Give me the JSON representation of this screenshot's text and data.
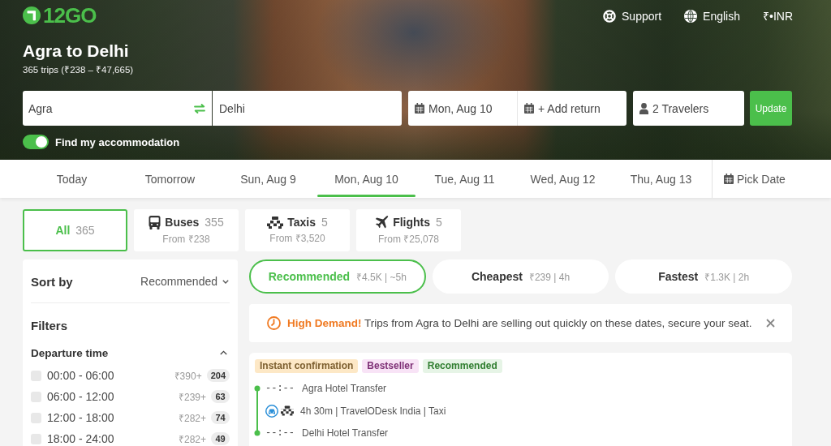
{
  "header": {
    "logo": "12GO",
    "links": [
      {
        "kind": "support",
        "label": "Support"
      },
      {
        "kind": "language",
        "label": "English"
      },
      {
        "kind": "currency",
        "label": "₹•INR"
      }
    ]
  },
  "route": {
    "title": "Agra to Delhi",
    "summary": "365 trips (₹238 – ₹47,665)"
  },
  "search": {
    "origin": "Agra",
    "destination": "Delhi",
    "date": "Mon, Aug 10",
    "return": "+ Add return",
    "travelers": "2 Travelers",
    "submit": "Update"
  },
  "accommodation": {
    "label": "Find my accommodation",
    "on": true
  },
  "date_tabs": [
    {
      "label": "Today",
      "selected": false
    },
    {
      "label": "Tomorrow",
      "selected": false
    },
    {
      "label": "Sun, Aug 9",
      "selected": false
    },
    {
      "label": "Mon, Aug 10",
      "selected": true
    },
    {
      "label": "Tue, Aug 11",
      "selected": false
    },
    {
      "label": "Wed, Aug 12",
      "selected": false
    },
    {
      "label": "Thu, Aug 13",
      "selected": false
    }
  ],
  "pick_date": "Pick Date",
  "modes": [
    {
      "kind": "all",
      "label": "All",
      "count": "365",
      "selected": true
    },
    {
      "kind": "bus",
      "label": "Buses",
      "count": "355",
      "price": "From ₹238",
      "selected": false
    },
    {
      "kind": "taxi",
      "label": "Taxis",
      "count": "5",
      "price": "From ₹3,520",
      "selected": false
    },
    {
      "kind": "flight",
      "label": "Flights",
      "count": "5",
      "price": "From ₹25,078",
      "selected": false
    }
  ],
  "sidebar": {
    "sort_title": "Sort by",
    "sort_value": "Recommended",
    "filters_title": "Filters",
    "departure_filter": {
      "title": "Departure time",
      "expanded": true,
      "options": [
        {
          "label": "00:00 - 06:00",
          "price": "₹390+",
          "count": "204",
          "checked": false
        },
        {
          "label": "06:00 - 12:00",
          "price": "₹239+",
          "count": "63",
          "checked": false
        },
        {
          "label": "12:00 - 18:00",
          "price": "₹282+",
          "count": "74",
          "checked": false
        },
        {
          "label": "18:00 - 24:00",
          "price": "₹282+",
          "count": "49",
          "checked": false
        }
      ]
    }
  },
  "sort_tabs": [
    {
      "label": "Recommended",
      "detail": "₹4.5K | ~5h",
      "selected": true
    },
    {
      "label": "Cheapest",
      "detail": "₹239 | 4h",
      "selected": false
    },
    {
      "label": "Fastest",
      "detail": "₹1.3K | 2h",
      "selected": false
    }
  ],
  "alert": {
    "message": "**High Demand!** Trips from Agra to Delhi are selling out quickly on these dates, secure your seat."
  },
  "trip": {
    "tags": [
      {
        "label": "Instant confirmation",
        "color": "#fde8c6"
      },
      {
        "label": "Bestseller",
        "color": "#f8e3f6"
      },
      {
        "label": "Recommended",
        "color": "#e6f4e6"
      }
    ],
    "departure": {
      "time": "--:--",
      "place": "Agra Hotel Transfer"
    },
    "segment": "4h 30m | TravelODesk India | Taxi",
    "arrival": {
      "time": "--:--",
      "place": "Delhi Hotel Transfer"
    }
  }
}
